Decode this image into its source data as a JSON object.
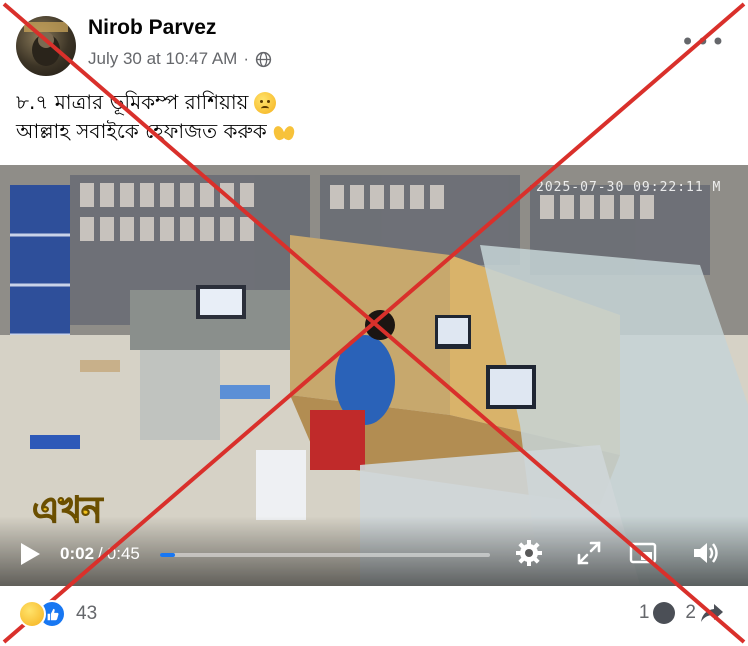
{
  "post": {
    "author": "Nirob Parvez",
    "timestamp": "July 30 at 10:47 AM",
    "separator": "·",
    "audience_icon": "globe-icon",
    "more_label": "•••",
    "caption_line1": "৮.৭ মাত্রার ভূমিকম্প রাশিয়ায়",
    "caption_line2": "আল্লাহ সবাইকে হেফাজত করুক"
  },
  "video": {
    "overlay_timestamp": "2025-07-30 09:22:11 M",
    "watermark": "এখন",
    "current_time": "0:02",
    "time_separator": "/",
    "duration": "0:45",
    "progress": 0.044,
    "controls": [
      "play-icon",
      "settings-icon",
      "fullscreen-icon",
      "pip-icon",
      "volume-icon"
    ]
  },
  "reactions": {
    "icons": [
      "sad-reaction-icon",
      "like-reaction-icon"
    ],
    "count": "43"
  },
  "footer": {
    "comment_count": "1",
    "share_count": "2"
  },
  "colors": {
    "accent": "#1877f2",
    "cross": "#d9302b",
    "secondary_text": "#65676b"
  }
}
